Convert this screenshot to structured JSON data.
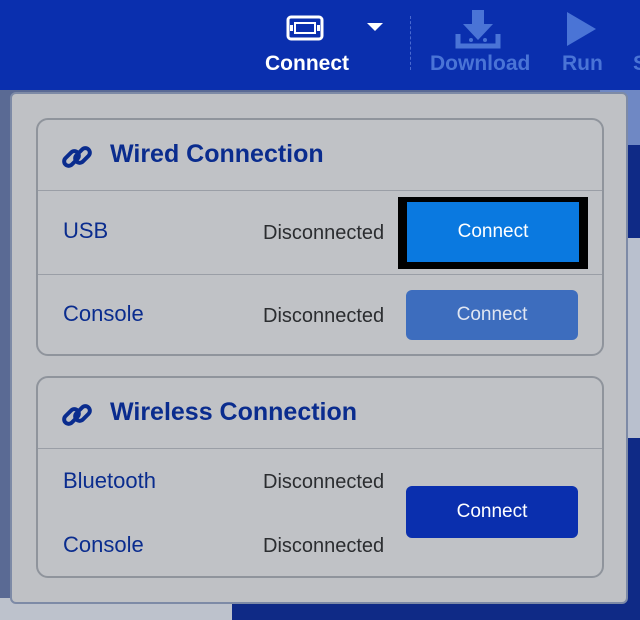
{
  "toolbar": {
    "connect_label": "Connect",
    "download_label": "Download",
    "run_label": "Run",
    "more_label": "S",
    "icons": {
      "connect": "device-icon",
      "dropdown": "chevron-down-icon",
      "download": "download-icon",
      "run": "play-icon"
    }
  },
  "wired": {
    "title": "Wired Connection",
    "icon": "link-icon",
    "rows": [
      {
        "label": "USB",
        "status": "Disconnected",
        "button": "Connect"
      },
      {
        "label": "Console",
        "status": "Disconnected",
        "button": "Connect"
      }
    ]
  },
  "wireless": {
    "title": "Wireless Connection",
    "icon": "link-icon",
    "rows": [
      {
        "label": "Bluetooth",
        "status": "Disconnected"
      },
      {
        "label": "Console",
        "status": "Disconnected"
      }
    ],
    "button": "Connect"
  },
  "colors": {
    "toolbar": "#0a2fae",
    "accent": "#0a79e0",
    "title_text": "#0a2c8e",
    "disabled_text": "#4a74d6"
  }
}
